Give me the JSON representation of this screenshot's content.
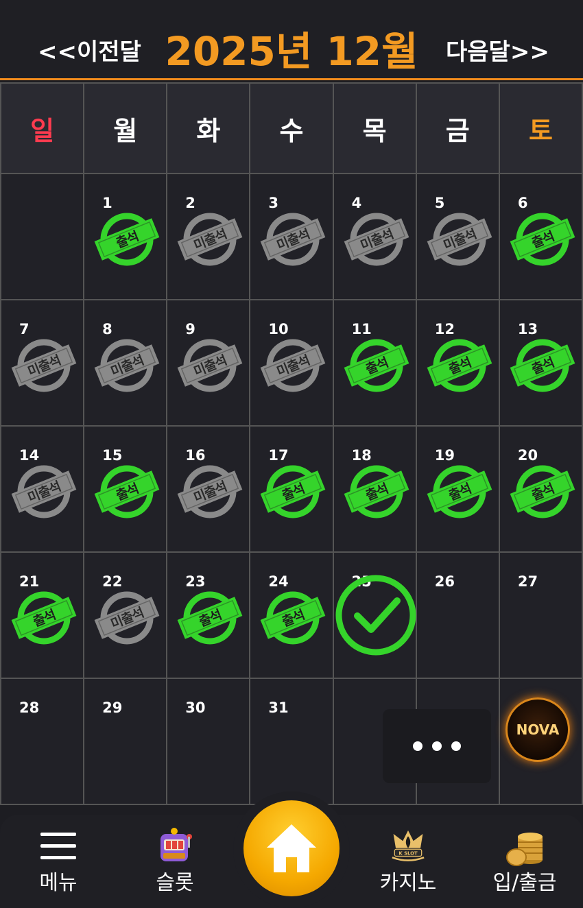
{
  "header": {
    "prev_label": "<<이전달",
    "title": "2025년 12월",
    "next_label": "다음달>>"
  },
  "weekdays": [
    "일",
    "월",
    "화",
    "수",
    "목",
    "금",
    "토"
  ],
  "stamp_labels": {
    "present": "출석",
    "absent": "미출석"
  },
  "weeks": [
    [
      {
        "day": "",
        "status": "none"
      },
      {
        "day": "1",
        "status": "present"
      },
      {
        "day": "2",
        "status": "absent"
      },
      {
        "day": "3",
        "status": "absent"
      },
      {
        "day": "4",
        "status": "absent"
      },
      {
        "day": "5",
        "status": "absent"
      },
      {
        "day": "6",
        "status": "present"
      }
    ],
    [
      {
        "day": "7",
        "status": "absent"
      },
      {
        "day": "8",
        "status": "absent"
      },
      {
        "day": "9",
        "status": "absent"
      },
      {
        "day": "10",
        "status": "absent"
      },
      {
        "day": "11",
        "status": "present"
      },
      {
        "day": "12",
        "status": "present"
      },
      {
        "day": "13",
        "status": "present"
      }
    ],
    [
      {
        "day": "14",
        "status": "absent"
      },
      {
        "day": "15",
        "status": "present"
      },
      {
        "day": "16",
        "status": "absent"
      },
      {
        "day": "17",
        "status": "present"
      },
      {
        "day": "18",
        "status": "present"
      },
      {
        "day": "19",
        "status": "present"
      },
      {
        "day": "20",
        "status": "present"
      }
    ],
    [
      {
        "day": "21",
        "status": "present"
      },
      {
        "day": "22",
        "status": "absent"
      },
      {
        "day": "23",
        "status": "present"
      },
      {
        "day": "24",
        "status": "present"
      },
      {
        "day": "25",
        "status": "today"
      },
      {
        "day": "26",
        "status": "none"
      },
      {
        "day": "27",
        "status": "none"
      }
    ],
    [
      {
        "day": "28",
        "status": "none"
      },
      {
        "day": "29",
        "status": "none"
      },
      {
        "day": "30",
        "status": "none"
      },
      {
        "day": "31",
        "status": "none"
      },
      {
        "day": "",
        "status": "none"
      },
      {
        "day": "",
        "status": "none"
      },
      {
        "day": "",
        "status": "none"
      }
    ]
  ],
  "floating": {
    "more_icon": "ellipsis-icon",
    "logo_text": "NOVA"
  },
  "bottom_nav": {
    "menu_label": "메뉴",
    "slot_label": "슬롯",
    "home_icon": "home-icon",
    "casino_label": "카지노",
    "casino_badge": "K SLOT",
    "deposit_label": "입/출금"
  },
  "colors": {
    "accent": "#f39a22",
    "sunday": "#ff3b4f",
    "present_stamp": "#35d42b",
    "absent_stamp": "#8a8a8a",
    "home_button": "#f5a800"
  }
}
